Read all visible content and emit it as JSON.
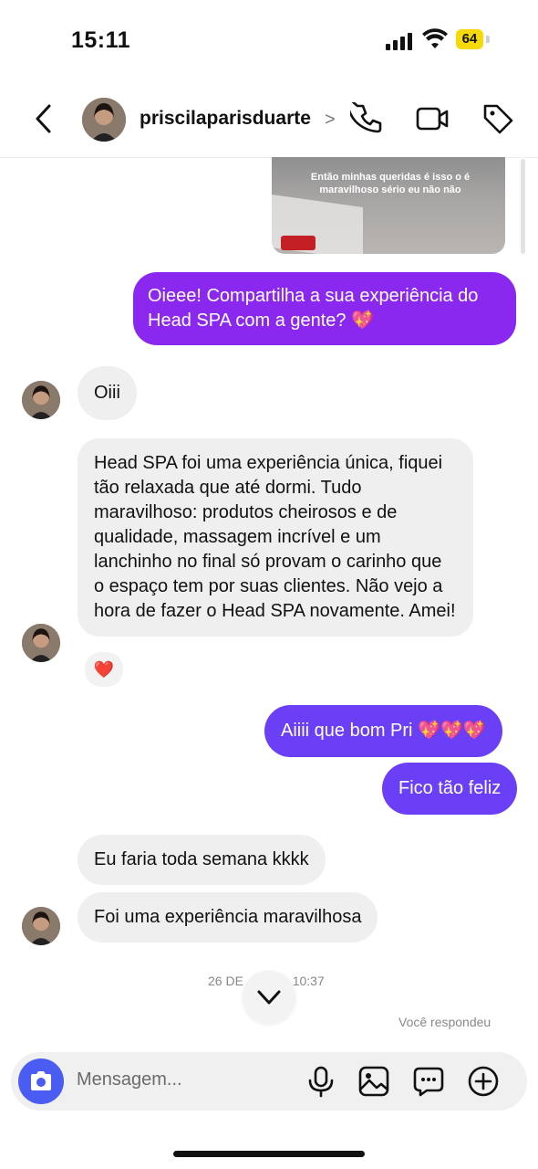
{
  "status_bar": {
    "time": "15:11",
    "battery": "64"
  },
  "header": {
    "username": "priscilaparisduarte"
  },
  "story_reply": {
    "caption": "Então minhas queridas é isso o é maravilhoso sério eu não não"
  },
  "messages": [
    {
      "text": "Oieee! Compartilha a sua experiência do Head SPA com a gente? 💖"
    },
    {
      "text": "Oiii"
    },
    {
      "text": "Head SPA foi uma experiência única, fiquei tão relaxada que até dormi. Tudo maravilhoso: produtos cheirosos e de qualidade, massagem incrível e um lanchinho no final só provam o carinho que o espaço tem por suas clientes. Não vejo a hora de fazer o Head SPA novamente. Amei!"
    },
    {
      "text": "Aiiii que bom Pri 💖💖💖"
    },
    {
      "text": "Fico tão feliz"
    },
    {
      "text": "Eu faria toda semana kkkk"
    },
    {
      "text": "Foi uma experiência maravilhosa"
    }
  ],
  "reaction": "❤️",
  "divider": {
    "date_left": "26 DE",
    "date_right": "10:37"
  },
  "replied_label": "Você respondeu",
  "composer": {
    "placeholder": "Mensagem..."
  },
  "colors": {
    "outgoing": "#8b28f0",
    "outgoing_alt": "#6b3ff5",
    "incoming": "#efefef",
    "camera": "#4a5cf1"
  }
}
